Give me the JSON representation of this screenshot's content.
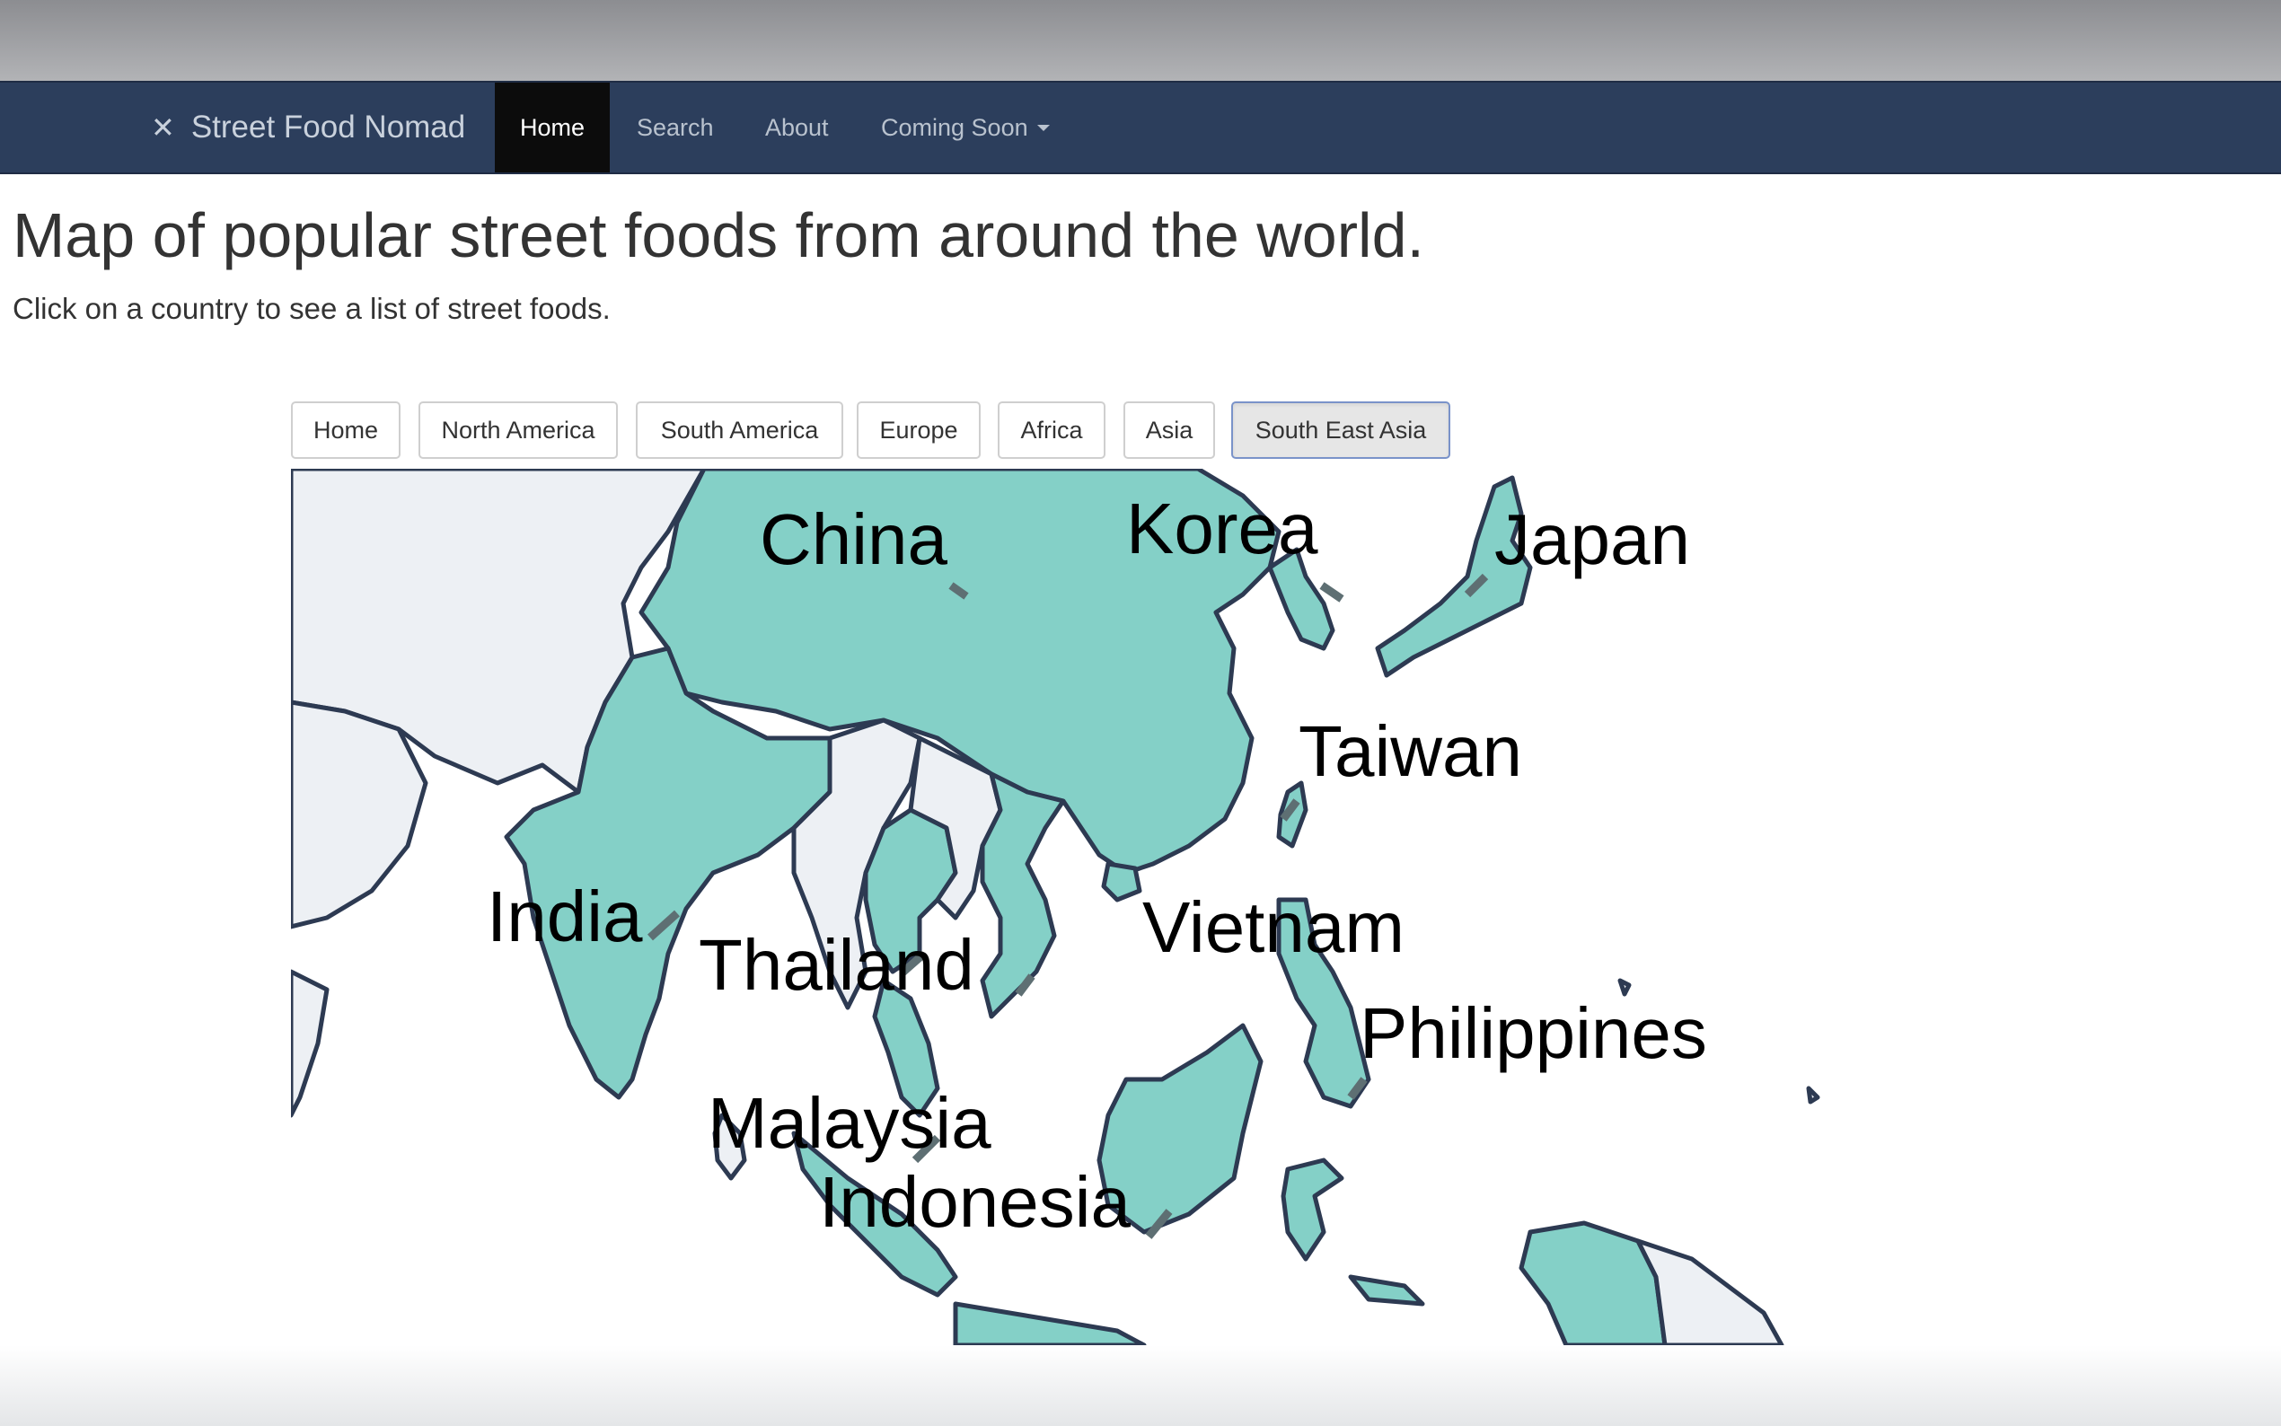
{
  "navbar": {
    "brand": "Street Food Nomad",
    "brand_icon": "fork-knife-icon",
    "items": [
      {
        "label": "Home",
        "active": true
      },
      {
        "label": "Search",
        "active": false
      },
      {
        "label": "About",
        "active": false
      },
      {
        "label": "Coming Soon",
        "active": false,
        "dropdown": true
      }
    ]
  },
  "main": {
    "title": "Map of popular street foods from around the world.",
    "subtitle": "Click on a country to see a list of street foods."
  },
  "regions": {
    "buttons": [
      "Home",
      "North America",
      "South America",
      "Europe",
      "Africa",
      "Asia",
      "South East Asia"
    ],
    "active": "South East Asia"
  },
  "map": {
    "labels": [
      "China",
      "Korea",
      "Japan",
      "Taiwan",
      "India",
      "Thailand",
      "Vietnam",
      "Philippines",
      "Malaysia",
      "Indonesia"
    ]
  },
  "colors": {
    "navbar": "#2c3e5c",
    "highlighted_country": "#84d0c7",
    "other_country": "#edf0f4",
    "border": "#2d3a52"
  }
}
